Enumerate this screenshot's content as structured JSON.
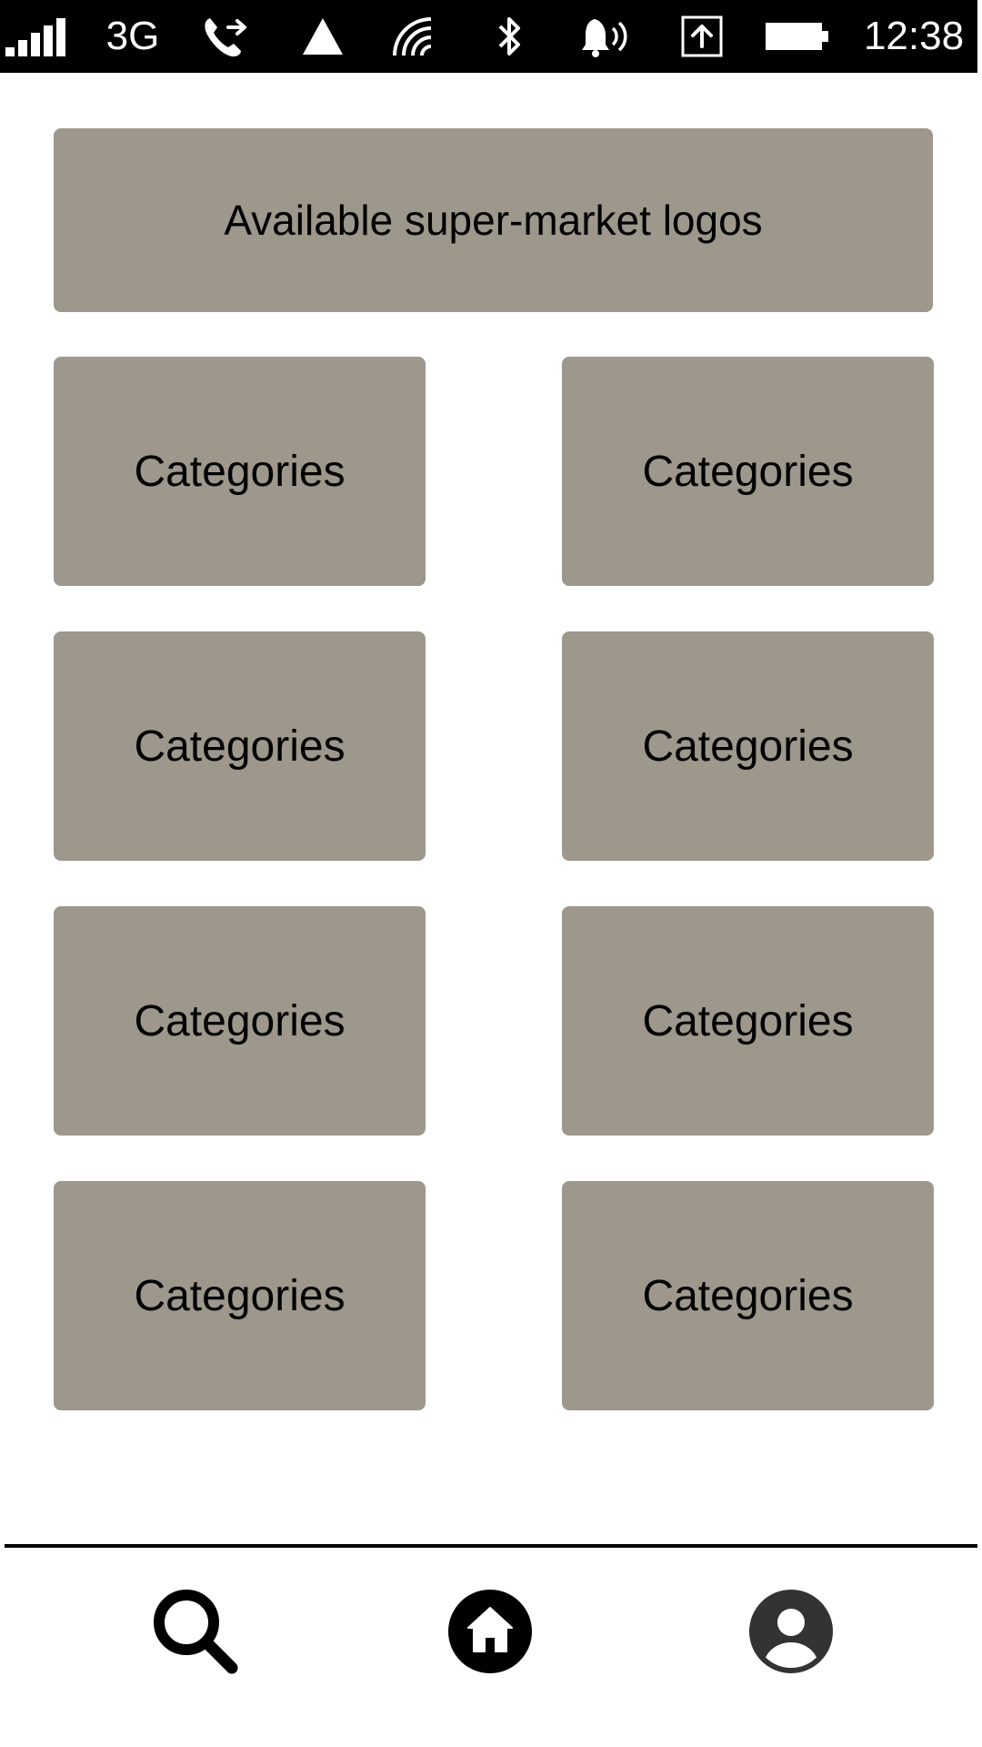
{
  "status_bar": {
    "network_type": "3G",
    "time": "12:38",
    "icons": [
      "signal-bars-icon",
      "call-forward-icon",
      "warning-triangle-icon",
      "wifi-icon",
      "bluetooth-icon",
      "ringer-volume-icon",
      "upload-icon",
      "battery-icon"
    ]
  },
  "banner": {
    "label": "Available super-market logos"
  },
  "categories": [
    {
      "label": "Categories"
    },
    {
      "label": "Categories"
    },
    {
      "label": "Categories"
    },
    {
      "label": "Categories"
    },
    {
      "label": "Categories"
    },
    {
      "label": "Categories"
    },
    {
      "label": "Categories"
    },
    {
      "label": "Categories"
    }
  ],
  "bottom_nav": {
    "items": [
      "search-icon",
      "home-icon",
      "profile-icon"
    ]
  },
  "colors": {
    "tile_background": "#9d978c",
    "status_bar_background": "#000000",
    "page_background": "#ffffff",
    "text": "#000000"
  }
}
